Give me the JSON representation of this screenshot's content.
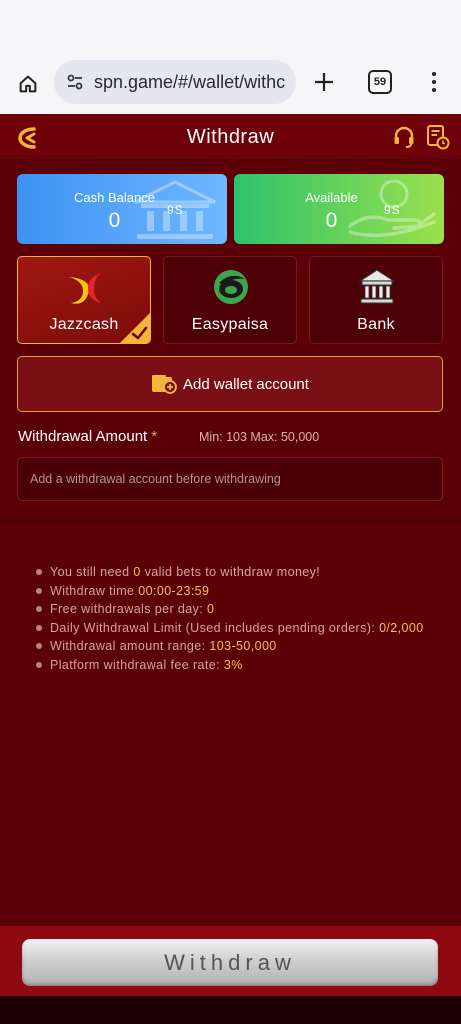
{
  "browser": {
    "url": "spn.game/#/wallet/withc",
    "tab_count": "59"
  },
  "header": {
    "title": "Withdraw"
  },
  "balances": {
    "cash": {
      "label": "Cash Balance",
      "value": "0",
      "refresh": "9S"
    },
    "available": {
      "label": "Available",
      "value": "0",
      "refresh": "9S"
    }
  },
  "methods": [
    {
      "label": "Jazzcash",
      "selected": true
    },
    {
      "label": "Easypaisa",
      "selected": false
    },
    {
      "label": "Bank",
      "selected": false
    }
  ],
  "add_wallet": {
    "label": "Add wallet account"
  },
  "amount": {
    "title": "Withdrawal Amount",
    "required_mark": "*",
    "range": "Min: 103 Max: 50,000",
    "placeholder": "Add a withdrawal account before withdrawing"
  },
  "rules": [
    {
      "prefix": "You still need ",
      "value": "0",
      "suffix": " valid bets to withdraw money!"
    },
    {
      "prefix": "Withdraw time ",
      "value": "00:00-23:59",
      "suffix": ""
    },
    {
      "prefix": "Free withdrawals per day: ",
      "value": "0",
      "suffix": ""
    },
    {
      "prefix": "Daily Withdrawal Limit (Used includes pending orders): ",
      "value": "0/2,000",
      "suffix": ""
    },
    {
      "prefix": "Withdrawal amount range: ",
      "value": "103-50,000",
      "suffix": ""
    },
    {
      "prefix": "Platform withdrawal fee rate: ",
      "value": "3%",
      "suffix": ""
    }
  ],
  "withdraw_button": {
    "label": "Withdraw"
  },
  "colors": {
    "background": "#5c0008",
    "accent_gold": "#f3b63a",
    "highlight": "#f6c04a",
    "cash_card": "#3d92f2",
    "available_card": "#2cc36c"
  },
  "icons": [
    "home-icon",
    "site-settings-icon",
    "plus-icon",
    "tabs-icon",
    "more-icon",
    "back-icon",
    "headset-icon",
    "records-icon",
    "bank-building-icon",
    "hand-coin-icon",
    "jazzcash-logo",
    "easypaisa-logo",
    "bank-icon",
    "check-icon",
    "wallet-add-icon"
  ]
}
